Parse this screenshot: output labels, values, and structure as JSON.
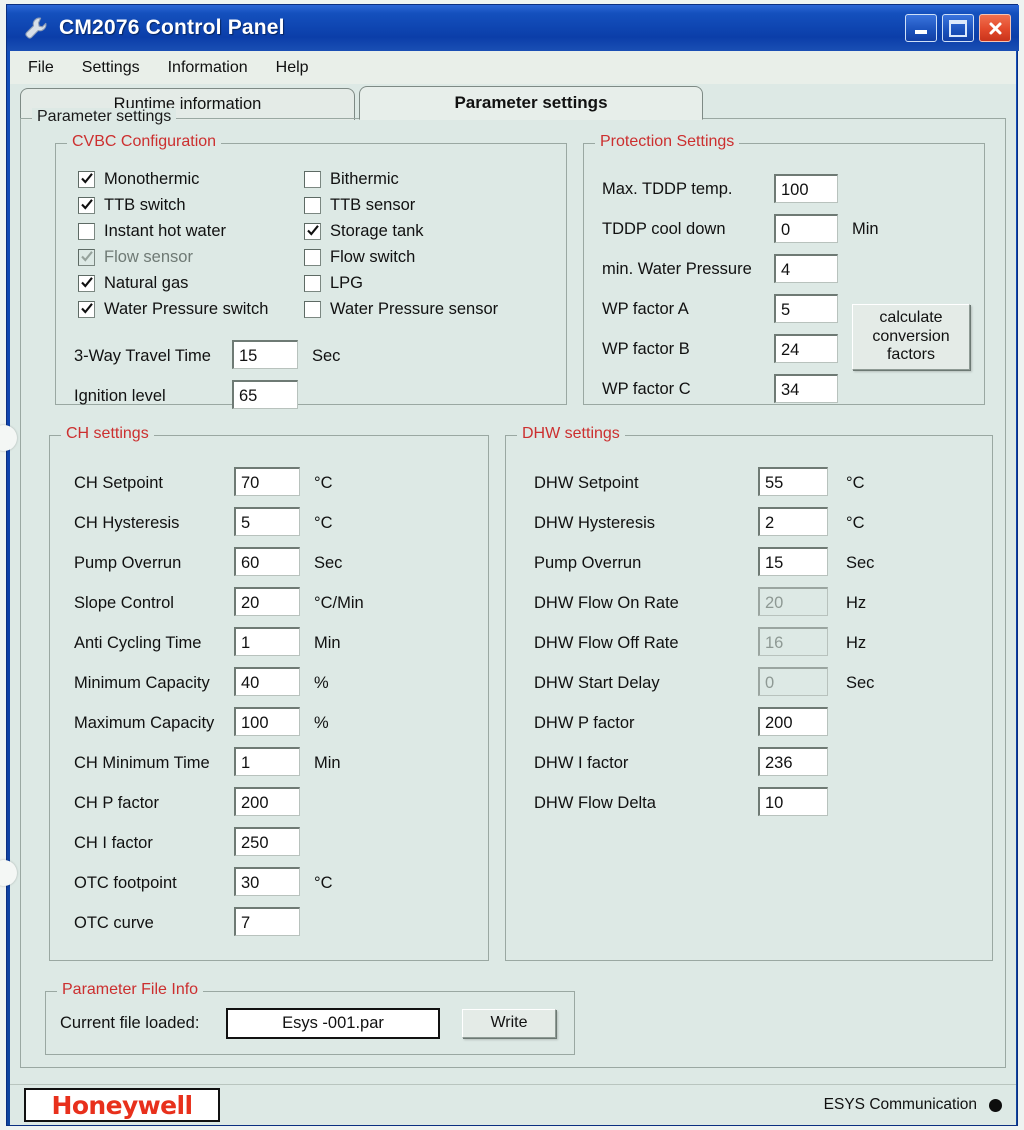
{
  "window": {
    "title": "CM2076 Control Panel",
    "icon": "wrench-icon",
    "minimize_label": "Minimize",
    "maximize_label": "Maximize",
    "close_label": "Close"
  },
  "menu": {
    "items": [
      {
        "label": "File"
      },
      {
        "label": "Settings"
      },
      {
        "label": "Information"
      },
      {
        "label": "Help"
      }
    ]
  },
  "tabs": [
    {
      "label": "Runtime information",
      "active": false
    },
    {
      "label": "Parameter settings",
      "active": true
    }
  ],
  "outer_group": {
    "title": "Parameter settings"
  },
  "cvbc": {
    "title": "CVBC Configuration",
    "checkboxes_left": [
      {
        "label": "Monothermic",
        "checked": true,
        "disabled": false
      },
      {
        "label": "TTB switch",
        "checked": true,
        "disabled": false
      },
      {
        "label": "Instant hot water",
        "checked": false,
        "disabled": false
      },
      {
        "label": "Flow sensor",
        "checked": true,
        "disabled": true
      },
      {
        "label": "Natural gas",
        "checked": true,
        "disabled": false
      },
      {
        "label": "Water Pressure switch",
        "checked": true,
        "disabled": false
      }
    ],
    "checkboxes_right": [
      {
        "label": "Bithermic",
        "checked": false,
        "disabled": false
      },
      {
        "label": "TTB sensor",
        "checked": false,
        "disabled": false
      },
      {
        "label": "Storage tank",
        "checked": true,
        "disabled": false
      },
      {
        "label": "Flow switch",
        "checked": false,
        "disabled": false
      },
      {
        "label": "LPG",
        "checked": false,
        "disabled": false
      },
      {
        "label": "Water Pressure sensor",
        "checked": false,
        "disabled": false
      }
    ],
    "fields": [
      {
        "label": "3-Way Travel Time",
        "value": "15",
        "unit": "Sec",
        "disabled": false
      },
      {
        "label": "Ignition level",
        "value": "65",
        "unit": "",
        "disabled": false
      }
    ]
  },
  "protection": {
    "title": "Protection Settings",
    "fields": [
      {
        "label": "Max. TDDP temp.",
        "value": "100",
        "unit": "",
        "disabled": false
      },
      {
        "label": "TDDP cool down",
        "value": "0",
        "unit": "Min",
        "disabled": false
      },
      {
        "label": "min. Water Pressure",
        "value": "4",
        "unit": "",
        "disabled": false
      },
      {
        "label": "WP factor A",
        "value": "5",
        "unit": "",
        "disabled": false
      },
      {
        "label": "WP factor B",
        "value": "24",
        "unit": "",
        "disabled": false
      },
      {
        "label": "WP factor C",
        "value": "34",
        "unit": "",
        "disabled": false
      }
    ],
    "calc_button": "calculate conversion factors"
  },
  "ch": {
    "title": "CH settings",
    "fields": [
      {
        "label": "CH Setpoint",
        "value": "70",
        "unit": "°C",
        "disabled": false
      },
      {
        "label": "CH Hysteresis",
        "value": "5",
        "unit": "°C",
        "disabled": false
      },
      {
        "label": "Pump Overrun",
        "value": "60",
        "unit": "Sec",
        "disabled": false
      },
      {
        "label": "Slope Control",
        "value": "20",
        "unit": "°C/Min",
        "disabled": false
      },
      {
        "label": "Anti Cycling Time",
        "value": "1",
        "unit": "Min",
        "disabled": false
      },
      {
        "label": "Minimum Capacity",
        "value": "40",
        "unit": "%",
        "disabled": false
      },
      {
        "label": "Maximum Capacity",
        "value": "100",
        "unit": "%",
        "disabled": false
      },
      {
        "label": "CH Minimum Time",
        "value": "1",
        "unit": "Min",
        "disabled": false
      },
      {
        "label": "CH P factor",
        "value": "200",
        "unit": "",
        "disabled": false
      },
      {
        "label": "CH I factor",
        "value": "250",
        "unit": "",
        "disabled": false
      },
      {
        "label": "OTC footpoint",
        "value": "30",
        "unit": "°C",
        "disabled": false
      },
      {
        "label": "OTC curve",
        "value": "7",
        "unit": "",
        "disabled": false
      }
    ]
  },
  "dhw": {
    "title": "DHW settings",
    "fields": [
      {
        "label": "DHW Setpoint",
        "value": "55",
        "unit": "°C",
        "disabled": false
      },
      {
        "label": "DHW Hysteresis",
        "value": "2",
        "unit": "°C",
        "disabled": false
      },
      {
        "label": "Pump Overrun",
        "value": "15",
        "unit": "Sec",
        "disabled": false
      },
      {
        "label": "DHW Flow On Rate",
        "value": "20",
        "unit": "Hz",
        "disabled": true
      },
      {
        "label": "DHW Flow Off Rate",
        "value": "16",
        "unit": "Hz",
        "disabled": true
      },
      {
        "label": "DHW Start Delay",
        "value": "0",
        "unit": "Sec",
        "disabled": true
      },
      {
        "label": "DHW P factor",
        "value": "200",
        "unit": "",
        "disabled": false
      },
      {
        "label": "DHW I factor",
        "value": "236",
        "unit": "",
        "disabled": false
      },
      {
        "label": "DHW Flow Delta",
        "value": "10",
        "unit": "",
        "disabled": false
      }
    ]
  },
  "file_info": {
    "title": "Parameter File Info",
    "label": "Current file loaded:",
    "value": "Esys -001.par",
    "write_button": "Write"
  },
  "status": {
    "logo": "Honeywell",
    "communication": "ESYS Communication",
    "led": "indicator-dot"
  },
  "colors": {
    "titlebar_blue": "#0c3ea6",
    "client_bg": "#dde9e5",
    "group_title_red": "#cc2f2f",
    "logo_red": "#e8301c",
    "close_red": "#e2492b"
  }
}
